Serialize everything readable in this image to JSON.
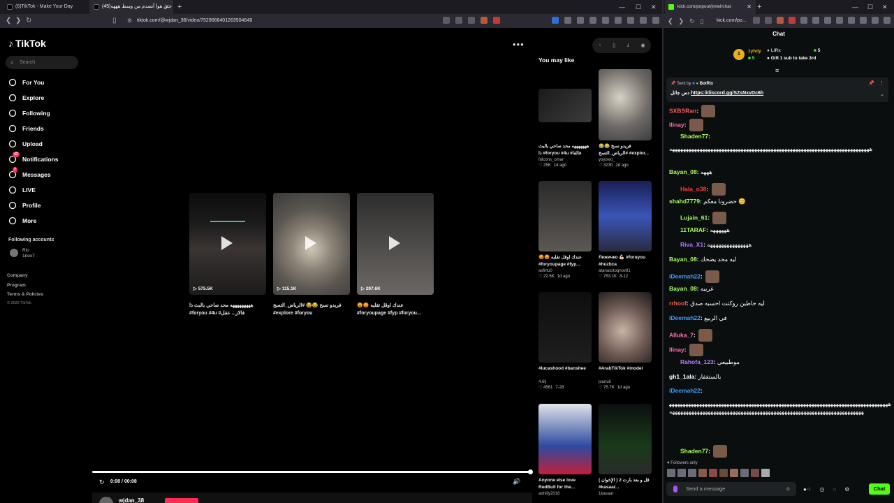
{
  "left_browser": {
    "tabs": [
      {
        "title": "(6)TikTok - Make Your Day"
      },
      {
        "title": "(45)جتن هوا أنصدم من وسط هههه"
      }
    ],
    "url": "tiktok.com/@wjdan_38/video/7529666401263504648",
    "window_controls": {
      "minimize": "—",
      "maximize": "☐",
      "close": "✕"
    }
  },
  "tiktok": {
    "logo": "TikTok",
    "search_placeholder": "Search",
    "nav": [
      {
        "label": "For You",
        "icon": "home-icon"
      },
      {
        "label": "Explore",
        "icon": "compass-icon"
      },
      {
        "label": "Following",
        "icon": "following-icon"
      },
      {
        "label": "Friends",
        "icon": "friends-icon"
      },
      {
        "label": "Upload",
        "icon": "upload-icon"
      },
      {
        "label": "Notifications",
        "icon": "bell-icon",
        "badge": "43"
      },
      {
        "label": "Messages",
        "icon": "paper-plane-icon",
        "badge": "7"
      },
      {
        "label": "LIVE",
        "icon": "live-icon"
      },
      {
        "label": "Profile",
        "icon": "profile-icon"
      },
      {
        "label": "More",
        "icon": "more-icon"
      }
    ],
    "following_accounts_title": "Following accounts",
    "following_account": {
      "name": "Rio",
      "handle": "1riox7"
    },
    "footer_links": [
      "Company",
      "Program",
      "Terms & Policies"
    ],
    "copyright": "© 2025 TikTok",
    "related_videos": [
      {
        "views": "575.5K",
        "caption": "هههههههههه محد صاحي بالبث ذا #foryou #4u #فالاز... عقل"
      },
      {
        "views": "115.1K",
        "caption": "فريدو نسخ 😂😂 #الرياض_التسخ #explore #foryou"
      },
      {
        "views": "297.6K",
        "caption": "😡😡 عندك اوقل تقلبه #foryoupage #fyp #foryou..."
      }
    ],
    "player": {
      "time": "0:08 / 00:08",
      "author": "wjdan_38",
      "progress": 1.0
    },
    "you_may_like_title": "You may like",
    "you_may_like": [
      {
        "caption": "هههههههه محد صاحي بالبث ذا #foryou #4u #فالقا",
        "author": "falcons_omar",
        "likes": "25K",
        "date": "1d ago"
      },
      {
        "caption": "فريدو نسخ 😂😂 #الرياض_التسخ #explor...",
        "author": "yoyowo_",
        "likes": "3230",
        "date": "2d ago"
      },
      {
        "caption": "😡😡 عندك اوقل تقلبه #foryoupage #fyp...",
        "author": "asfirtu0",
        "likes": "22.5K",
        "date": "1d ago"
      },
      {
        "caption": "Лежичко 💪🏻 #foruyou #huzbca",
        "author": "atanasstoqnov81",
        "likes": "753.1K",
        "date": "8-12"
      },
      {
        "caption": "#lucashood #banshee",
        "author": "4.6lj",
        "likes": "4561",
        "date": "7-28"
      },
      {
        "caption": "#ArabTikTok #model",
        "author": "jounuit",
        "likes": "75.7K",
        "date": "1d ago"
      },
      {
        "caption": "Anyone else love RedBull for the...",
        "author": "adnilly2018",
        "likes": "",
        "date": ""
      },
      {
        "caption": "قل و بعد بارت 2 ( الإخوان ) #kasaar...",
        "author": "1kasaar",
        "likes": "",
        "date": ""
      }
    ]
  },
  "right_browser": {
    "tab_title": "kick.com/popout/jmtel/chat",
    "url": "kick.com/po...",
    "chat_title": "Chat",
    "leaderboard": [
      {
        "rank": "1",
        "name": "1yhdy",
        "count": "5"
      },
      {
        "name": "LiRx",
        "count": "5"
      },
      {
        "text": "Gift 1 sub to take 3rd"
      }
    ],
    "pinned": {
      "sent_by": "Sent by",
      "bot": "BotRix",
      "prefix": "دس جاتل",
      "link": "https://discord.gg/SZsNxvDc6h"
    },
    "messages": [
      {
        "user": "SXBSRan",
        "color": "#ff5a5a",
        "text": ""
      },
      {
        "user": "Ilinay",
        "color": "#ff6fae",
        "text": ""
      },
      {
        "user": "Shaden77",
        "color": "#a8ff60",
        "text": ""
      },
      {
        "user": "",
        "color": "#fff",
        "text": "هههههههههههههههههههههههههههههههههههههههههههههههههههههههههههههههههههههههههه"
      },
      {
        "user": "Bayan_08",
        "color": "#a8ff60",
        "text": "هههه"
      },
      {
        "user": "Hala_o38",
        "color": "#ff3b3b",
        "text": ""
      },
      {
        "user": "shahd7779",
        "color": "#a8ff60",
        "text": "حضرونا معكم 😊"
      },
      {
        "user": "Lujain_61",
        "color": "#a8ff60",
        "text": ""
      },
      {
        "user": "11TARAF",
        "color": "#a8ff60",
        "text": "ههههههه"
      },
      {
        "user": "Riva_X1",
        "color": "#b37cff",
        "text": "هههههههههههههههه"
      },
      {
        "user": "Bayan_08",
        "color": "#a8ff60",
        "text": "ليه محد يضحك"
      },
      {
        "user": "iDeemah22",
        "color": "#3aa0ff",
        "text": ""
      },
      {
        "user": "Bayan_08",
        "color": "#a8ff60",
        "text": "غريبه"
      },
      {
        "user": "rrhoof",
        "color": "#ff5a5a",
        "text": "ليه حاطين روكتت احسبه صدق"
      },
      {
        "user": "iDeemah22",
        "color": "#3aa0ff",
        "text": "في الربيع"
      },
      {
        "user": "Alluka_7",
        "color": "#ff6fae",
        "text": ""
      },
      {
        "user": "Ilinay",
        "color": "#ff6fae",
        "text": ""
      },
      {
        "user": "Rahofa_123",
        "color": "#b37cff",
        "text": "موطبيعي"
      },
      {
        "user": "gh1_1ala",
        "color": "#fff",
        "text": "بالستغفار"
      },
      {
        "user": "iDeemah22",
        "color": "#3aa0ff",
        "text": ""
      },
      {
        "user": "",
        "color": "#fff",
        "text": "هههههههههههههههههههههههههههههههههههههههههههههههههههههههههههههههههههههههههههههههههههههههههههههههههههههههههههههههههههههههههههههههههههههههههههههههههههههههه"
      },
      {
        "user": "Shaden77",
        "color": "#a8ff60",
        "text": ""
      }
    ],
    "followers_only": "Followers only",
    "message_placeholder": "Send a message",
    "chat_button": "Chat"
  }
}
